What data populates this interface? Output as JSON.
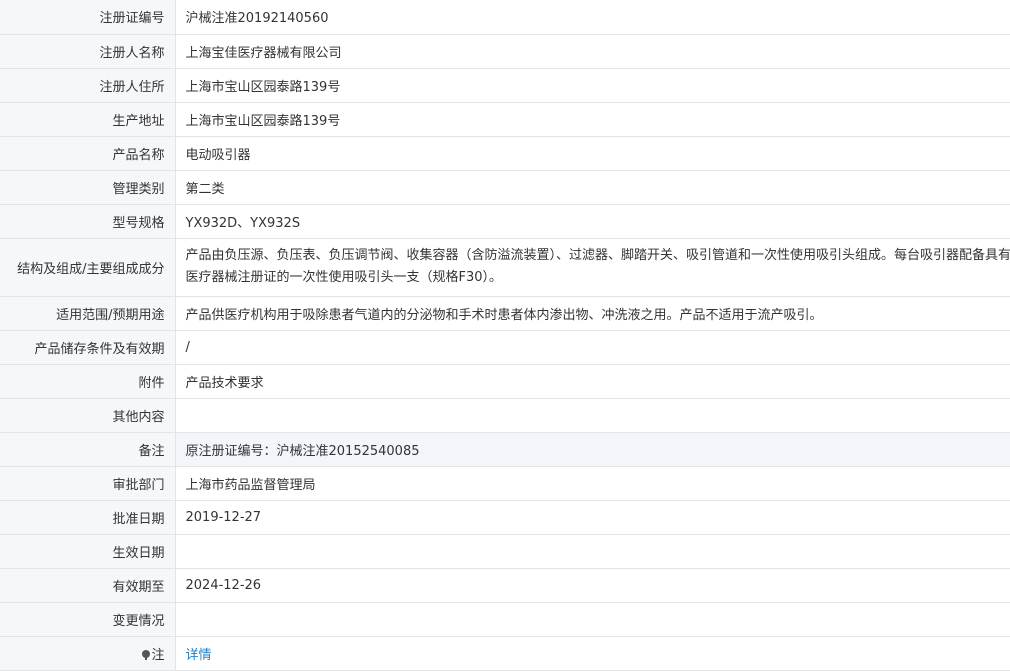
{
  "rows": [
    {
      "label": "注册证编号",
      "value": "沪械注准20192140560"
    },
    {
      "label": "注册人名称",
      "value": "上海宝佳医疗器械有限公司"
    },
    {
      "label": "注册人住所",
      "value": "上海市宝山区园泰路139号"
    },
    {
      "label": "生产地址",
      "value": "上海市宝山区园泰路139号"
    },
    {
      "label": "产品名称",
      "value": "电动吸引器"
    },
    {
      "label": "管理类别",
      "value": "第二类"
    },
    {
      "label": "型号规格",
      "value": "YX932D、YX932S"
    },
    {
      "label": "结构及组成/主要组成成分",
      "value": "产品由负压源、负压表、负压调节阀、收集容器（含防溢流装置）、过滤器、脚踏开关、吸引管道和一次性使用吸引头组成。每台吸引器配备具有有效医疗器械注册证的一次性使用吸引头一支（规格F30）。"
    },
    {
      "label": "适用范围/预期用途",
      "value": "产品供医疗机构用于吸除患者气道内的分泌物和手术时患者体内渗出物、冲洗液之用。产品不适用于流产吸引。"
    },
    {
      "label": "产品储存条件及有效期",
      "value": "/"
    },
    {
      "label": "附件",
      "value": "产品技术要求"
    },
    {
      "label": "其他内容",
      "value": ""
    },
    {
      "label": "备注",
      "value": "原注册证编号：沪械注准20152540085"
    },
    {
      "label": "审批部门",
      "value": "上海市药品监督管理局"
    },
    {
      "label": "批准日期",
      "value": "2019-12-27"
    },
    {
      "label": "生效日期",
      "value": ""
    },
    {
      "label": "有效期至",
      "value": "2024-12-26"
    },
    {
      "label": "变更情况",
      "value": ""
    },
    {
      "label": "注",
      "value": "详情"
    }
  ],
  "icons": {
    "note_icon": "pin-icon"
  },
  "colors": {
    "label_bg": "#f6f7f9",
    "highlight_bg": "#f2f6fa",
    "border": "#e4e4e4",
    "link": "#1f7fc9",
    "text": "#333333"
  }
}
